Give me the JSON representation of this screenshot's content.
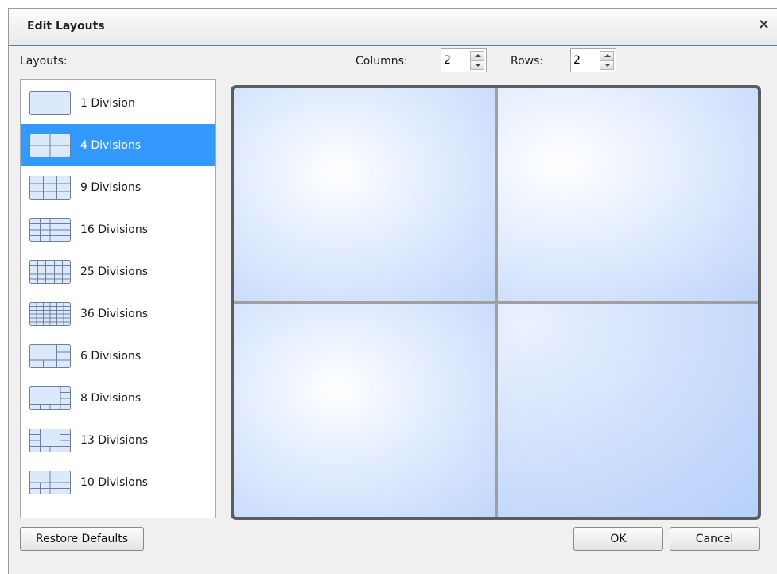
{
  "dialog": {
    "title": "Edit Layouts",
    "close_glyph": "×"
  },
  "layouts": {
    "label": "Layouts:",
    "selected_index": 1,
    "items": [
      {
        "label": "1 Division",
        "icon": "layout-1x1-icon"
      },
      {
        "label": "4 Divisions",
        "icon": "layout-2x2-icon"
      },
      {
        "label": "9 Divisions",
        "icon": "layout-3x3-icon"
      },
      {
        "label": "16 Divisions",
        "icon": "layout-4x4-icon"
      },
      {
        "label": "25 Divisions",
        "icon": "layout-5x5-icon"
      },
      {
        "label": "36 Divisions",
        "icon": "layout-6x6-icon"
      },
      {
        "label": "6 Divisions",
        "icon": "layout-6-icon"
      },
      {
        "label": "8 Divisions",
        "icon": "layout-8-icon"
      },
      {
        "label": "13 Divisions",
        "icon": "layout-13-icon"
      },
      {
        "label": "10 Divisions",
        "icon": "layout-10-icon"
      }
    ]
  },
  "grid_controls": {
    "columns_label": "Columns:",
    "columns_value": "2",
    "rows_label": "Rows:",
    "rows_value": "2"
  },
  "preview": {
    "columns": 2,
    "rows": 2
  },
  "buttons": {
    "restore_defaults": "Restore Defaults",
    "ok": "OK",
    "cancel": "Cancel"
  },
  "colors": {
    "selection": "#3399ff",
    "title_underline": "#4f80b3",
    "preview_border": "#5c5c5c"
  }
}
